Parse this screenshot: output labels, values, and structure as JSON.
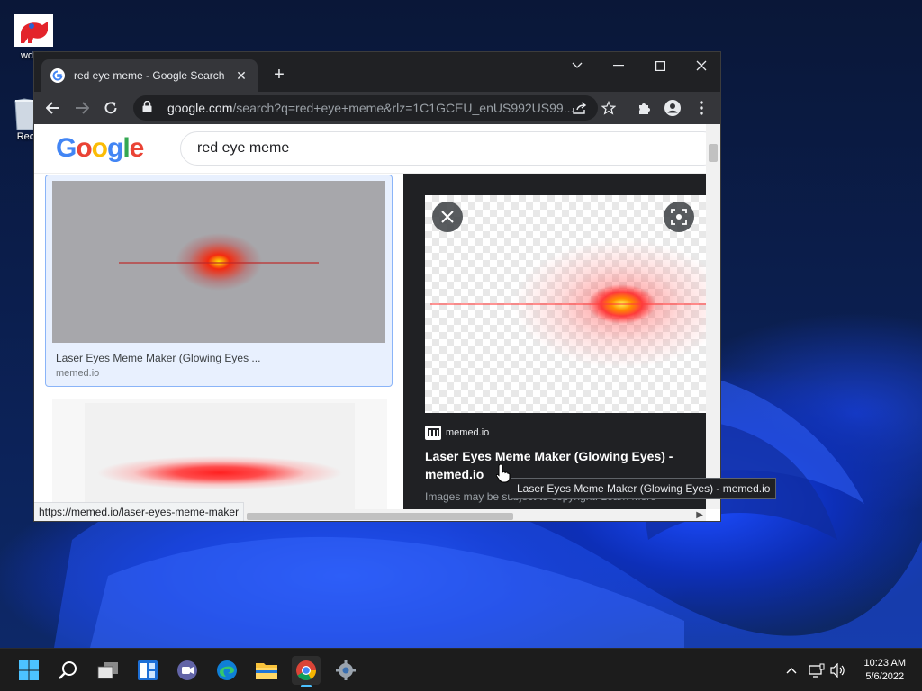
{
  "desktop": {
    "icons": [
      {
        "label": "wdcnj"
      },
      {
        "label": "Recyc"
      }
    ]
  },
  "browser": {
    "tab_title": "red eye meme - Google Search",
    "tab_close": "✕",
    "new_tab": "+",
    "address_host": "google.com",
    "address_path": "/search?q=red+eye+meme&rlz=1C1GCEU_enUS992US99..."
  },
  "search": {
    "logo": [
      "G",
      "o",
      "o",
      "g",
      "l",
      "e"
    ],
    "query": "red eye meme"
  },
  "results": {
    "card_title": "Laser Eyes Meme Maker (Glowing Eyes ...",
    "card_source": "memed.io"
  },
  "preview": {
    "source": "memed.io",
    "title": "Laser Eyes Meme Maker (Glowing Eyes) - memed.io",
    "note": "Images may be subject to copyright. Learn More"
  },
  "status_url": "https://memed.io/laser-eyes-meme-maker",
  "tooltip": "Laser Eyes Meme Maker (Glowing Eyes) - memed.io",
  "taskbar": {
    "time": "10:23 AM",
    "date": "5/6/2022",
    "accent": "#4cc2ff"
  }
}
